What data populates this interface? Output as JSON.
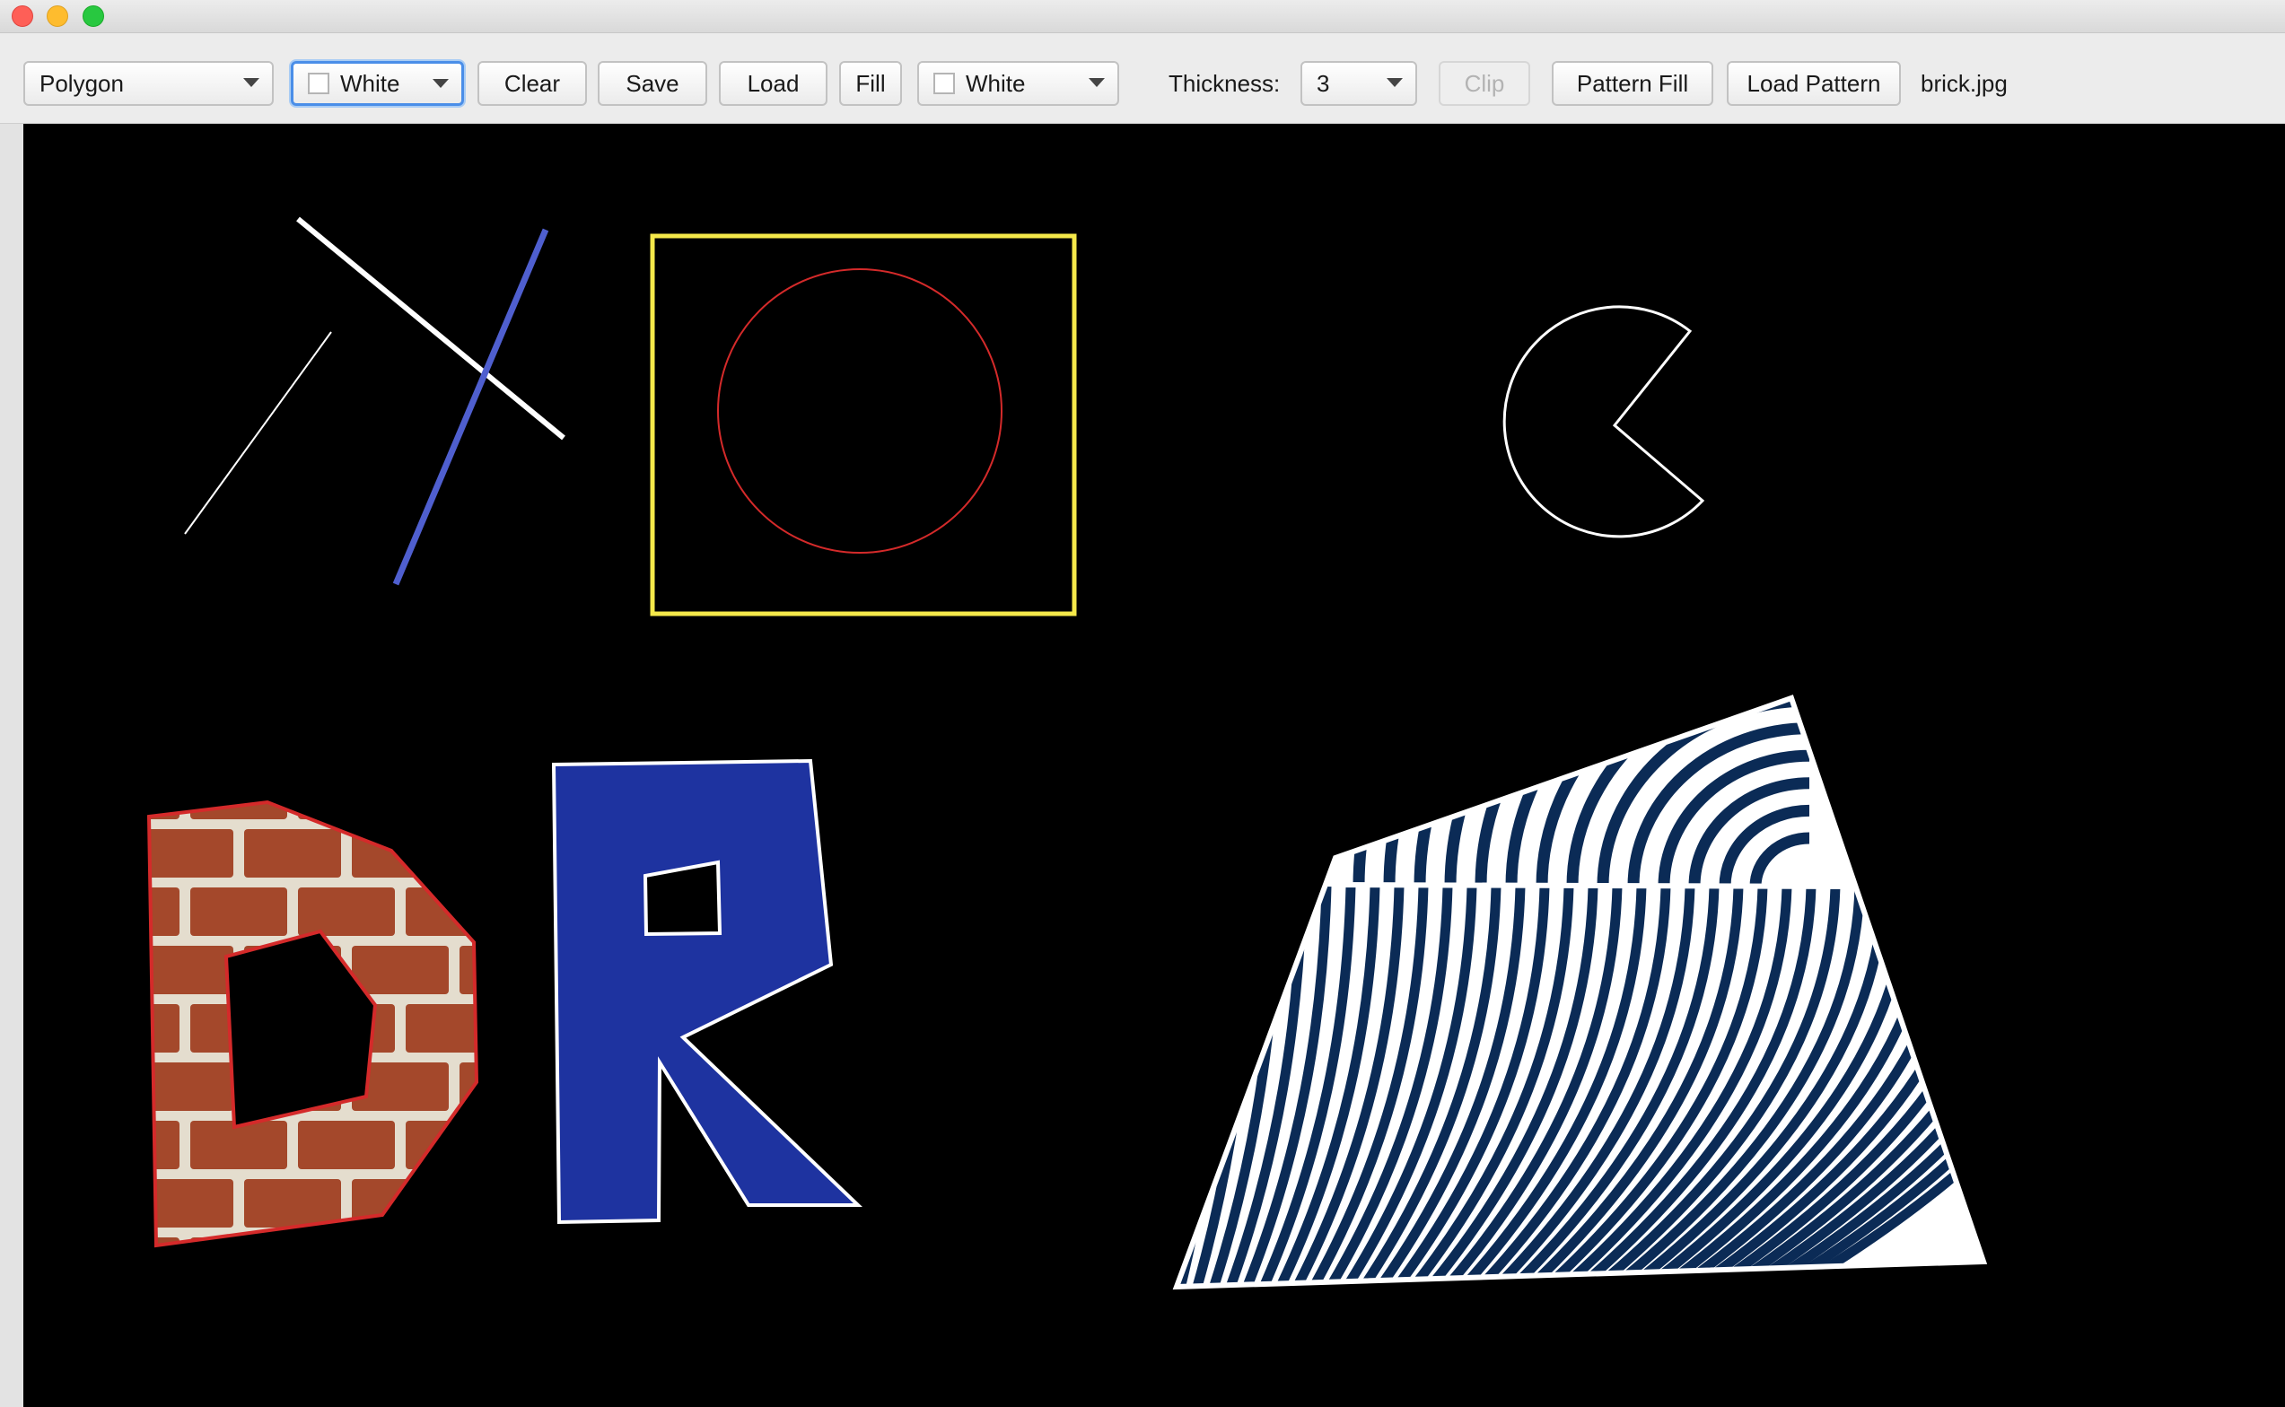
{
  "toolbar": {
    "shape_select": "Polygon",
    "stroke_color": {
      "label": "White",
      "swatch": "#ffffff"
    },
    "clear_label": "Clear",
    "save_label": "Save",
    "load_label": "Load",
    "fill_label": "Fill",
    "fill_color": {
      "label": "White",
      "swatch": "#ffffff"
    },
    "thickness_label": "Thickness:",
    "thickness_value": "3",
    "clip_label": "Clip",
    "pattern_fill_label": "Pattern Fill",
    "load_pattern_label": "Load Pattern",
    "pattern_file": "brick.jpg"
  },
  "canvas": {
    "background": "#000000",
    "shapes": [
      {
        "name": "line",
        "stroke": "#ffffff"
      },
      {
        "name": "thick-line",
        "stroke": "#ffffff"
      },
      {
        "name": "line",
        "stroke": "#4f5fcf"
      },
      {
        "name": "rectangle",
        "stroke": "#f5e94a"
      },
      {
        "name": "circle",
        "stroke": "#d42a2a"
      },
      {
        "name": "pie-arc",
        "stroke": "#ffffff"
      },
      {
        "name": "polygon-D",
        "stroke": "#d42a2a",
        "fill": "brick-pattern"
      },
      {
        "name": "polygon-R",
        "stroke": "#ffffff",
        "fill": "#1e33a0"
      },
      {
        "name": "polygon-quad",
        "stroke": "#ffffff",
        "fill": "stripe-pattern"
      }
    ],
    "colors": {
      "stripe_dark": "#0b2b56",
      "brick": "#a4482b",
      "mortar": "#e4ddce",
      "blue": "#1e33a0"
    }
  }
}
